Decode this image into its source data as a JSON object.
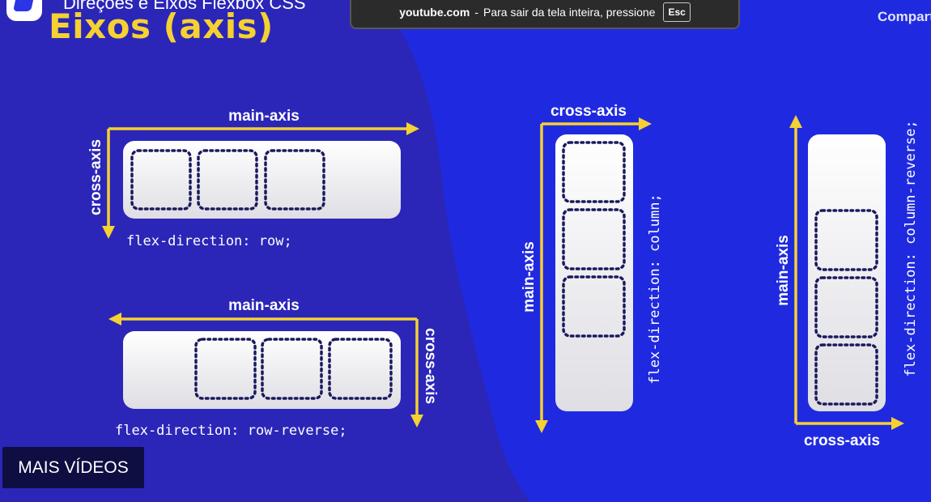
{
  "video": {
    "title": "Direções e Eixos Flexbox CSS",
    "slide_title": "Eixos (axis)",
    "share_label": "Compartilhar"
  },
  "fullscreen_toast": {
    "domain": "youtube.com",
    "separator": "-",
    "message": "Para sair da tela inteira, pressione",
    "key": "Esc"
  },
  "more_videos_label": "MAIS VÍDEOS",
  "diagrams": {
    "row": {
      "main_axis": "main-axis",
      "cross_axis": "cross-axis",
      "code": "flex-direction: row;"
    },
    "row_reverse": {
      "main_axis": "main-axis",
      "cross_axis": "cross-axis",
      "code": "flex-direction: row-reverse;"
    },
    "column": {
      "main_axis": "main-axis",
      "cross_axis": "cross-axis",
      "code": "flex-direction: column;"
    },
    "column_reverse": {
      "main_axis": "main-axis",
      "cross_axis": "cross-axis",
      "code": "flex-direction: column-reverse;"
    }
  },
  "colors": {
    "background": "#1f2ae0",
    "blob": "#2b26b8",
    "arrow": "#f5d132",
    "title": "#f5d132",
    "item_dots": "#1a1a5e"
  }
}
